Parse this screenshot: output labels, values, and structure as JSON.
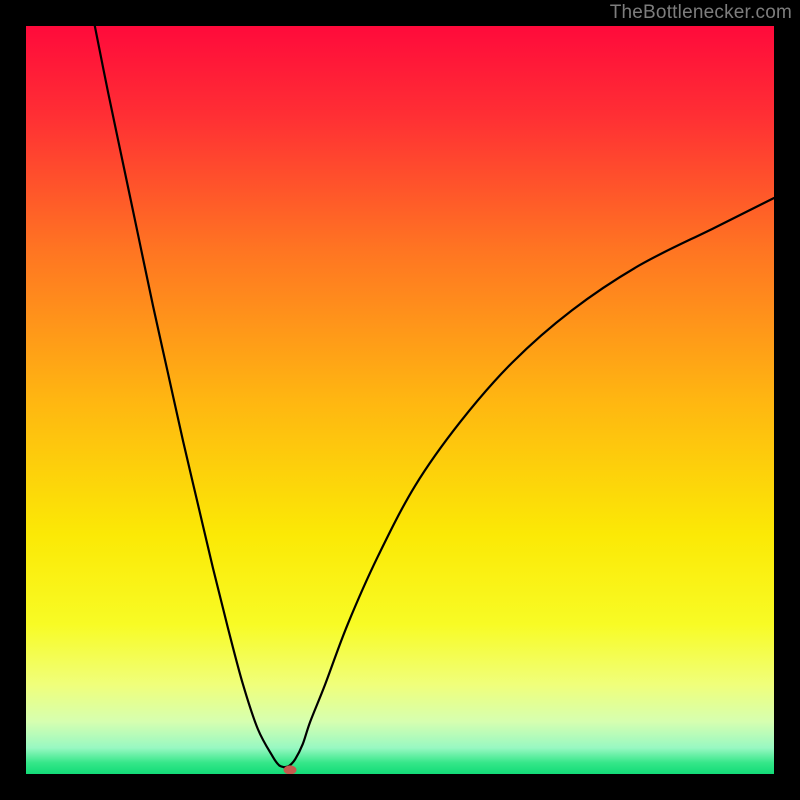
{
  "attribution": "TheBottlenecker.com",
  "chart_data": {
    "type": "line",
    "title": "",
    "xlabel": "",
    "ylabel": "",
    "xlim": [
      0,
      100
    ],
    "ylim": [
      0,
      100
    ],
    "gradient_stops": [
      {
        "offset": 0.0,
        "color": "#ff0a3b"
      },
      {
        "offset": 0.12,
        "color": "#ff2f34"
      },
      {
        "offset": 0.3,
        "color": "#ff7522"
      },
      {
        "offset": 0.5,
        "color": "#ffb611"
      },
      {
        "offset": 0.68,
        "color": "#fbe905"
      },
      {
        "offset": 0.8,
        "color": "#f8fb25"
      },
      {
        "offset": 0.88,
        "color": "#f0ff7a"
      },
      {
        "offset": 0.93,
        "color": "#d6ffb0"
      },
      {
        "offset": 0.965,
        "color": "#98f8c2"
      },
      {
        "offset": 0.985,
        "color": "#35e789"
      },
      {
        "offset": 1.0,
        "color": "#12db77"
      }
    ],
    "series": [
      {
        "name": "bottleneck-curve",
        "x": [
          9.2,
          11,
          13,
          15,
          17,
          19,
          21,
          23,
          25,
          27,
          29,
          31,
          33,
          33.8,
          34.5,
          35.2,
          36,
          37,
          38,
          40,
          43,
          47,
          52,
          58,
          65,
          73,
          82,
          92,
          100
        ],
        "y": [
          100,
          91,
          81.5,
          72,
          62.5,
          53.5,
          44.5,
          36,
          27.5,
          19.5,
          12,
          6,
          2.3,
          1.2,
          0.9,
          1.1,
          2,
          4,
          7,
          12,
          20,
          29,
          38.5,
          47,
          55,
          62,
          68,
          73,
          77
        ]
      }
    ],
    "marker": {
      "x": 35.3,
      "y": 0.55,
      "color": "#c55a4e"
    },
    "curve_minimum_x": 34.5
  }
}
